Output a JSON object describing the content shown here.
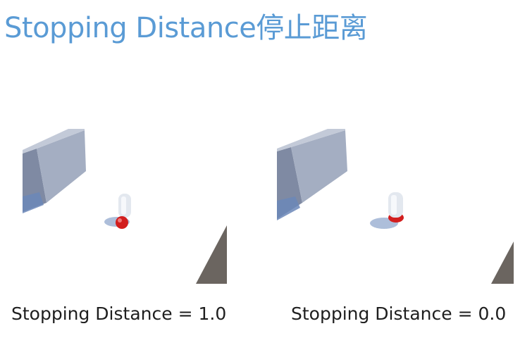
{
  "slide": {
    "title": "Stopping Distance停止距离"
  },
  "scenes": [
    {
      "caption": "Stopping Distance = 1.0"
    },
    {
      "caption": "Stopping Distance = 0.0"
    }
  ],
  "colors": {
    "title": "#5a9bd5",
    "wall": "#9aa6bd",
    "ramp": "#6b6560",
    "target_sphere": "#d21e1e",
    "agent": "#e7ecf3"
  }
}
